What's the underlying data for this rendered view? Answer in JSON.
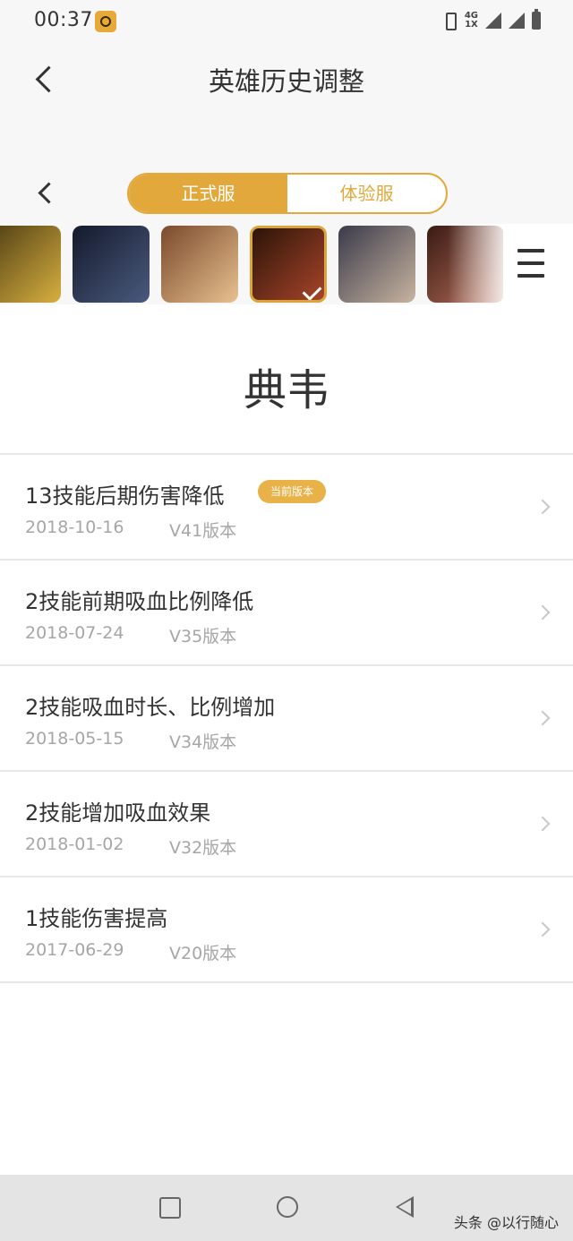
{
  "status_bar": {
    "time": "00:37",
    "network": "4G",
    "network_sub": "1X"
  },
  "header": {
    "title": "英雄历史调整"
  },
  "server_tabs": [
    {
      "label": "正式服",
      "active": true
    },
    {
      "label": "体验服",
      "active": false
    }
  ],
  "hero_strip": {
    "heroes": [
      {
        "icon": "golden-armor-hero-portrait",
        "colors": [
          "#4a3a12",
          "#d8b040"
        ]
      },
      {
        "icon": "dark-haired-hero-portrait",
        "colors": [
          "#141a2c",
          "#4a5a7e"
        ]
      },
      {
        "icon": "eyepatch-hero-portrait",
        "colors": [
          "#7a4a2c",
          "#e8c190"
        ]
      },
      {
        "icon": "dianwei-hero-portrait",
        "colors": [
          "#2c1408",
          "#a8442a"
        ],
        "selected": true
      },
      {
        "icon": "white-beard-hero-portrait",
        "colors": [
          "#3a3a4a",
          "#c8b4a0"
        ]
      },
      {
        "icon": "red-haired-hero-portrait",
        "colors": [
          "#3a1a14",
          "#b8705a"
        ]
      }
    ]
  },
  "hero_name": "典韦",
  "adjustments": [
    {
      "title": "13技能后期伤害降低",
      "badge": "当前版本",
      "date": "2018-10-16",
      "version": "V41版本"
    },
    {
      "title": "2技能前期吸血比例降低",
      "date": "2018-07-24",
      "version": "V35版本"
    },
    {
      "title": "2技能吸血时长、比例增加",
      "date": "2018-05-15",
      "version": "V34版本"
    },
    {
      "title": "2技能增加吸血效果",
      "date": "2018-01-02",
      "version": "V32版本"
    },
    {
      "title": "1技能伤害提高",
      "date": "2017-06-29",
      "version": "V20版本"
    }
  ],
  "watermark": "头条 @以行随心",
  "colors": {
    "accent": "#e2a83c",
    "badge": "#e9b249",
    "text": "#333333",
    "subtext": "#a6a6a6"
  }
}
